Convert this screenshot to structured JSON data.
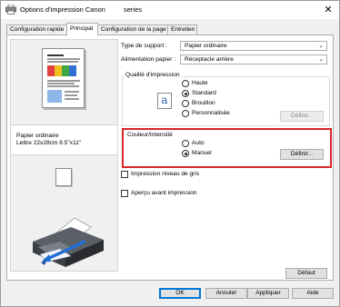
{
  "window": {
    "title": "Options d'impression Canon",
    "title_suffix": "series",
    "close_glyph": "✕"
  },
  "tabs": [
    {
      "label": "Configuration rapide",
      "active": false
    },
    {
      "label": "Principal",
      "active": true
    },
    {
      "label": "Configuration de la page",
      "active": false
    },
    {
      "label": "Entretien",
      "active": false
    }
  ],
  "preview": {
    "paper_line1": "Papier ordinaire",
    "paper_line2": "Lettre 22x28cm 8.5\"x11\""
  },
  "media": {
    "type_label": "Type de support :",
    "type_value": "Papier ordinaire",
    "source_label": "Alimentation papier :",
    "source_value": "Réceptacle arrière"
  },
  "quality": {
    "group_label": "Qualité d'impression",
    "icon_glyph": "a",
    "options": [
      "Haute",
      "Standard",
      "Brouillon",
      "Personnalisée"
    ],
    "selected": "Standard",
    "define_label": "Définir..."
  },
  "color": {
    "group_label": "Couleur/Intensité",
    "options": [
      "Auto",
      "Manuel"
    ],
    "selected": "Manuel",
    "define_label": "Définir..."
  },
  "checkboxes": {
    "grayscale": "Impression niveau de gris",
    "preview": "Aperçu avant impression"
  },
  "buttons": {
    "default": "Défaut",
    "ok": "OK",
    "cancel": "Annuler",
    "apply": "Appliquer",
    "help": "Aide"
  },
  "colors": {
    "highlight": "#d9262c",
    "accent": "#0078d7"
  },
  "icons": {
    "app": "canon-printer-icon",
    "close": "close-icon",
    "quality": "text-quality-icon",
    "dropdown": "chevron-down-icon"
  }
}
